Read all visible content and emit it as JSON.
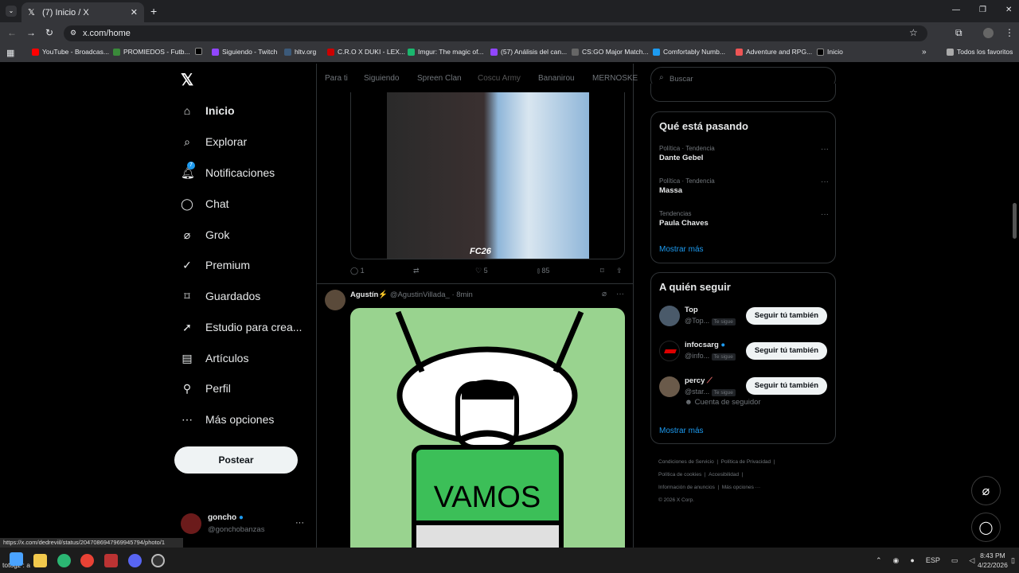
{
  "browser": {
    "tab_title": "(7) Inicio / X",
    "url": "x.com/home",
    "bookmarks": [
      "YouTube - Broadcas...",
      "PROMIEDOS - Futb...",
      "",
      "Siguiendo - Twitch",
      "hltv.org",
      "C.R.O X DUKI - LEX...",
      "Imgur: The magic of...",
      "(57) Análisis del can...",
      "CS:GO Major Match...",
      "Comfortably Numb...",
      "Adventure and RPG...",
      "Inicio"
    ],
    "all_bookmarks": "Todos los favoritos"
  },
  "nav": {
    "items": [
      "Inicio",
      "Explorar",
      "Notificaciones",
      "Chat",
      "Grok",
      "Premium",
      "Guardados",
      "Estudio para crea...",
      "Artículos",
      "Perfil",
      "Más opciones"
    ],
    "notif_badge": "7",
    "post_label": "Postear",
    "account_name": "goncho",
    "account_handle": "@gonchobanzas"
  },
  "feed_tabs": [
    "Para ti",
    "Siguiendo",
    "Spreen Clan",
    "Coscu Army",
    "Bananirou",
    "MERNOSKE"
  ],
  "post1": {
    "replies": "1",
    "likes": "5",
    "views": "85",
    "image_caption": "FC26"
  },
  "post2": {
    "name": "Agustín⚡",
    "handle": "@AgustinVillada_",
    "time": "· 8min",
    "image_text": "VAMOS"
  },
  "search": {
    "placeholder": "Buscar"
  },
  "trends": {
    "title": "Qué está pasando",
    "items": [
      {
        "context": "Política · Tendencia",
        "name": "Dante Gebel"
      },
      {
        "context": "Política · Tendencia",
        "name": "Massa"
      },
      {
        "context": "Tendencias",
        "name": "Paula Chaves"
      }
    ],
    "more": "Mostrar más"
  },
  "who_to_follow": {
    "title": "A quién seguir",
    "users": [
      {
        "name": "Top",
        "handle": "@Top...",
        "badge": "Te sigue",
        "button": "Seguir tú también"
      },
      {
        "name": "infocsarg",
        "handle": "@info...",
        "badge": "Te sigue",
        "button": "Seguir tú también"
      },
      {
        "name": "percy",
        "handle": "@star...",
        "badge": "Te sigue",
        "button": "Seguir tú también",
        "note": "Cuenta de seguidor"
      }
    ],
    "more": "Mostrar más"
  },
  "footer": [
    "Condiciones de Servicio",
    "Política de Privacidad",
    "Política de cookies",
    "Accesibilidad",
    "Información de anuncios",
    "Más opciones ···",
    "© 2026 X Corp."
  ],
  "status_url": "https://x.com/dedreviil/status/2047086947969945794/photo/1",
  "taskbar": {
    "user": "totogz : a",
    "lang": "ESP",
    "time": "8:43 PM",
    "date": "4/22/2026"
  }
}
